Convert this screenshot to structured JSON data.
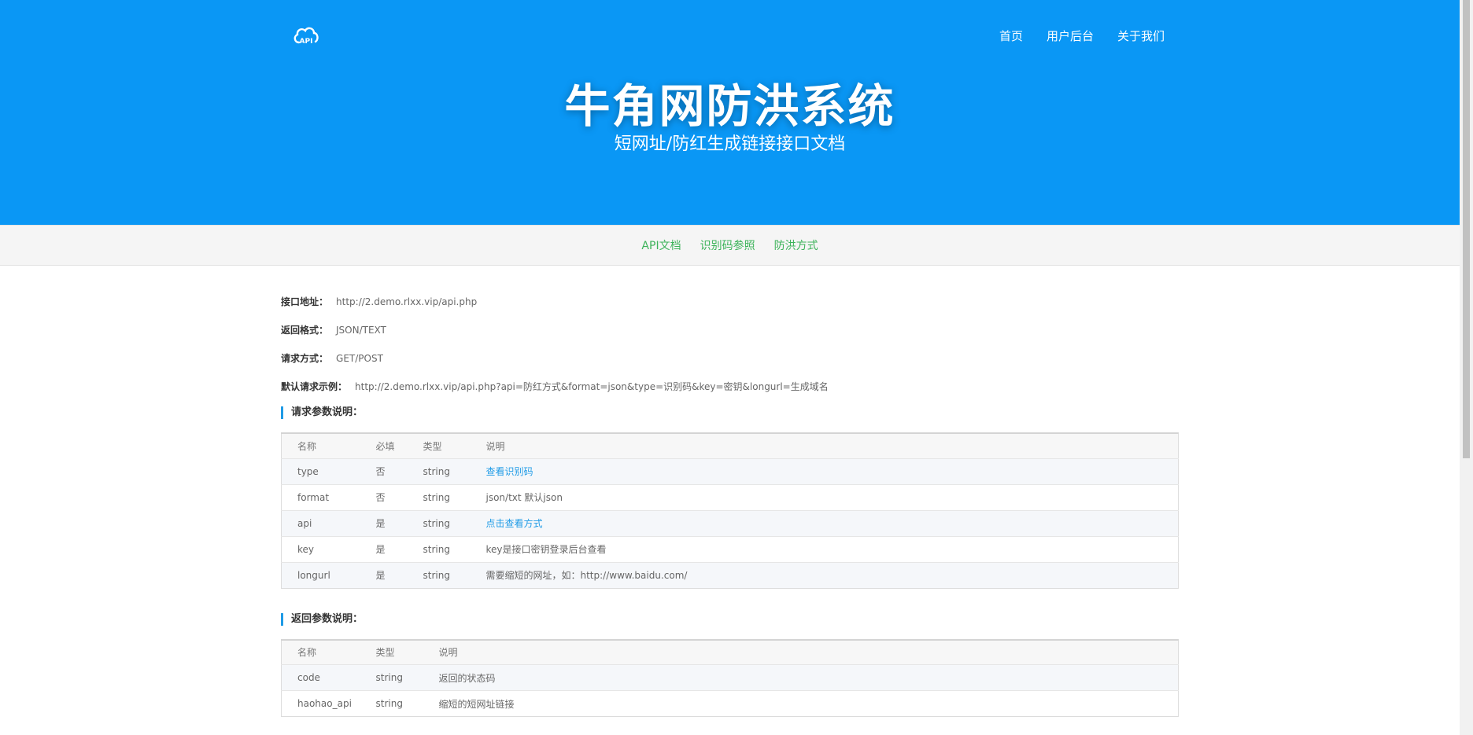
{
  "header": {
    "logo_text": "API",
    "nav": [
      "首页",
      "用户后台",
      "关于我们"
    ],
    "title": "牛角网防洪系统",
    "subtitle": "短网址/防红生成链接接口文档"
  },
  "subnav": [
    "API文档",
    "识别码参照",
    "防洪方式"
  ],
  "info": [
    {
      "label": "接口地址：",
      "value": "http://2.demo.rlxx.vip/api.php"
    },
    {
      "label": "返回格式：",
      "value": "JSON/TEXT"
    },
    {
      "label": "请求方式：",
      "value": "GET/POST"
    },
    {
      "label": "默认请求示例：",
      "value": "http://2.demo.rlxx.vip/api.php?api=防红方式&format=json&type=识别码&key=密钥&longurl=生成域名"
    }
  ],
  "request_section": {
    "title": "请求参数说明：",
    "headers": [
      "名称",
      "必填",
      "类型",
      "说明"
    ],
    "rows": [
      [
        "type",
        "否",
        "string",
        "查看识别码"
      ],
      [
        "format",
        "否",
        "string",
        "json/txt 默认json"
      ],
      [
        "api",
        "是",
        "string",
        "点击查看方式"
      ],
      [
        "key",
        "是",
        "string",
        "key是接口密钥登录后台查看"
      ],
      [
        "longurl",
        "是",
        "string",
        "需要缩短的网址，如：http://www.baidu.com/"
      ]
    ]
  },
  "response_section": {
    "title": "返回参数说明：",
    "headers": [
      "名称",
      "类型",
      "说明"
    ],
    "rows": [
      [
        "code",
        "string",
        "返回的状态码"
      ],
      [
        "haohao_api",
        "string",
        "缩短的短网址链接"
      ]
    ]
  },
  "colors": {
    "brand": "#0a97f5",
    "link": "#1f9be6",
    "subnav_link": "#3db35a"
  }
}
